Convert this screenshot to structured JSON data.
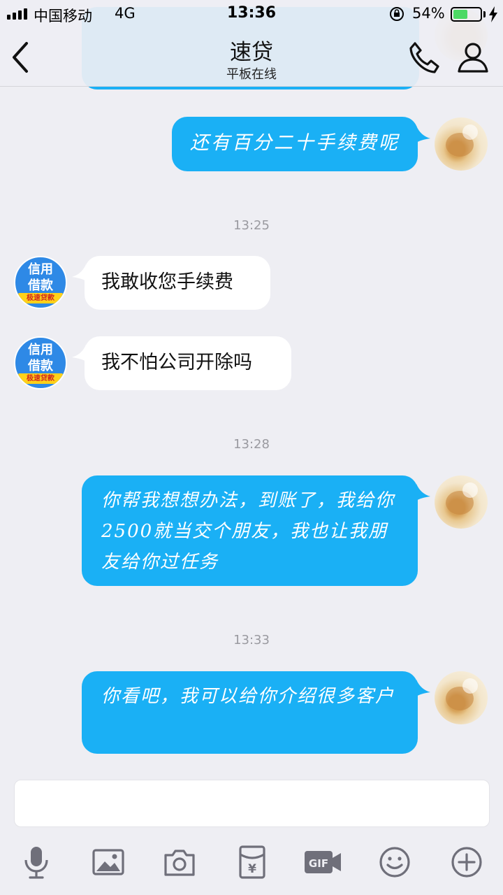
{
  "status_bar": {
    "carrier": "中国移动",
    "network": "4G",
    "time": "13:36",
    "battery_percent": "54%",
    "battery_level": 0.54
  },
  "header": {
    "title": "速贷",
    "subtitle": "平板在线"
  },
  "colors": {
    "outgoing_bubble": "#1ab0f5",
    "incoming_bubble": "#ffffff",
    "background": "#eeeef3"
  },
  "messages": [
    {
      "direction": "out",
      "text": "还有百分二十手续费呢"
    },
    {
      "type": "time",
      "text": "13:25"
    },
    {
      "direction": "in",
      "text": "我敢收您手续费"
    },
    {
      "direction": "in",
      "text": "我不怕公司开除吗"
    },
    {
      "type": "time",
      "text": "13:28"
    },
    {
      "direction": "out",
      "text": "你帮我想想办法，到账了，我给你2500就当交个朋友，我也让我朋友给你过任务"
    },
    {
      "type": "time",
      "text": "13:33"
    },
    {
      "direction": "out",
      "text": "你看吧，我可以给你介绍很多客户"
    }
  ],
  "bot_avatar": {
    "line1": "信用",
    "line2": "借款",
    "ribbon": "极速贷款"
  },
  "toolbar": {
    "icons": [
      "microphone-icon",
      "image-icon",
      "camera-icon",
      "red-packet-icon",
      "gif-icon",
      "emoji-icon",
      "plus-icon"
    ],
    "gif_label": "GIF",
    "red_packet_symbol": "¥"
  }
}
